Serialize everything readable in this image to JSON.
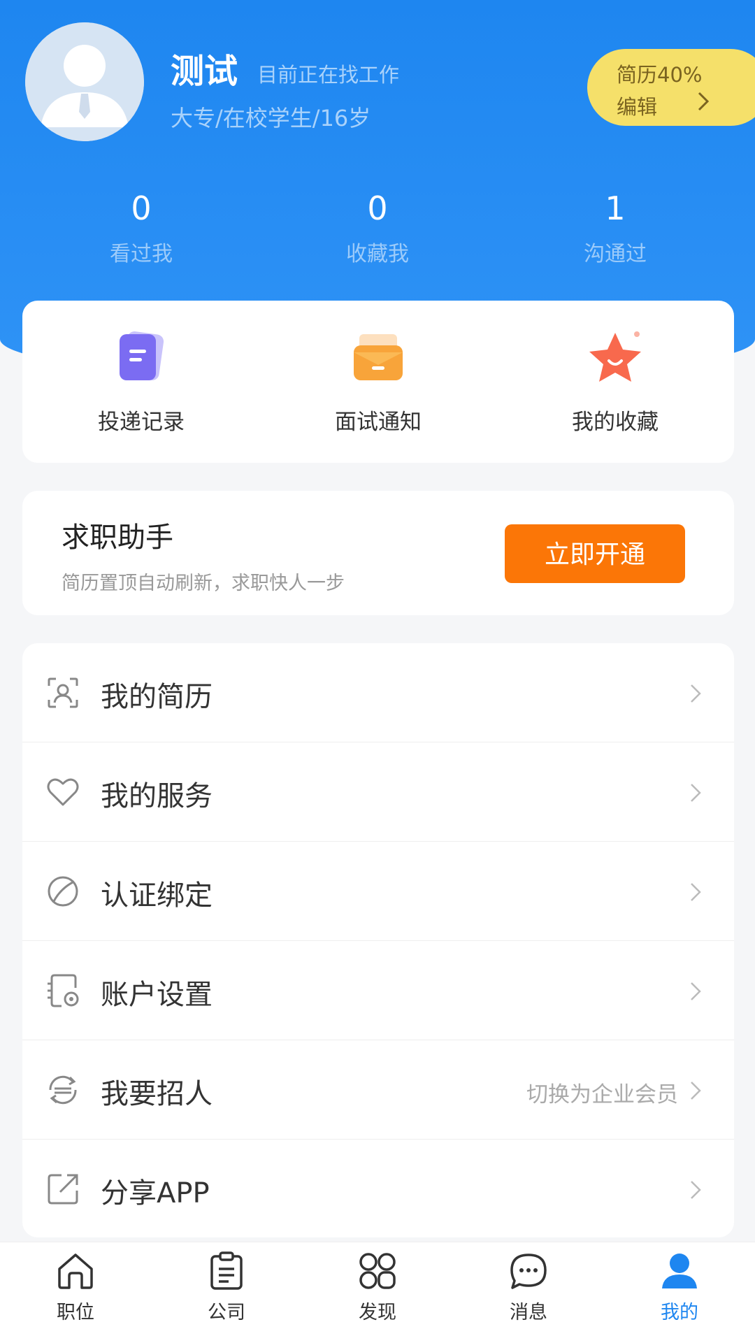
{
  "profile": {
    "name": "测试",
    "status": "目前正在找工作",
    "meta": "大专/在校学生/16岁",
    "resume_progress": "简历40%",
    "edit_label": "编辑"
  },
  "stats": [
    {
      "value": "0",
      "label": "看过我"
    },
    {
      "value": "0",
      "label": "收藏我"
    },
    {
      "value": "1",
      "label": "沟通过"
    }
  ],
  "quick_links": [
    {
      "label": "投递记录",
      "icon": "document-icon"
    },
    {
      "label": "面试通知",
      "icon": "mail-icon"
    },
    {
      "label": "我的收藏",
      "icon": "star-icon"
    }
  ],
  "assistant": {
    "title": "求职助手",
    "subtitle": "简历置顶自动刷新，求职快人一步",
    "button": "立即开通"
  },
  "menu": [
    {
      "label": "我的简历",
      "icon": "resume-icon",
      "hint": ""
    },
    {
      "label": "我的服务",
      "icon": "heart-icon",
      "hint": ""
    },
    {
      "label": "认证绑定",
      "icon": "leaf-icon",
      "hint": ""
    },
    {
      "label": "账户设置",
      "icon": "settings-icon",
      "hint": ""
    },
    {
      "label": "我要招人",
      "icon": "switch-icon",
      "hint": "切换为企业会员"
    },
    {
      "label": "分享APP",
      "icon": "share-icon",
      "hint": ""
    }
  ],
  "tabs": [
    {
      "label": "职位",
      "icon": "home-icon"
    },
    {
      "label": "公司",
      "icon": "clipboard-icon"
    },
    {
      "label": "发现",
      "icon": "grid-icon"
    },
    {
      "label": "消息",
      "icon": "chat-icon"
    },
    {
      "label": "我的",
      "icon": "user-icon",
      "active": true
    }
  ],
  "colors": {
    "primary": "#1e86f0",
    "accent_orange": "#fb7607",
    "badge_yellow": "#f5e06a"
  }
}
